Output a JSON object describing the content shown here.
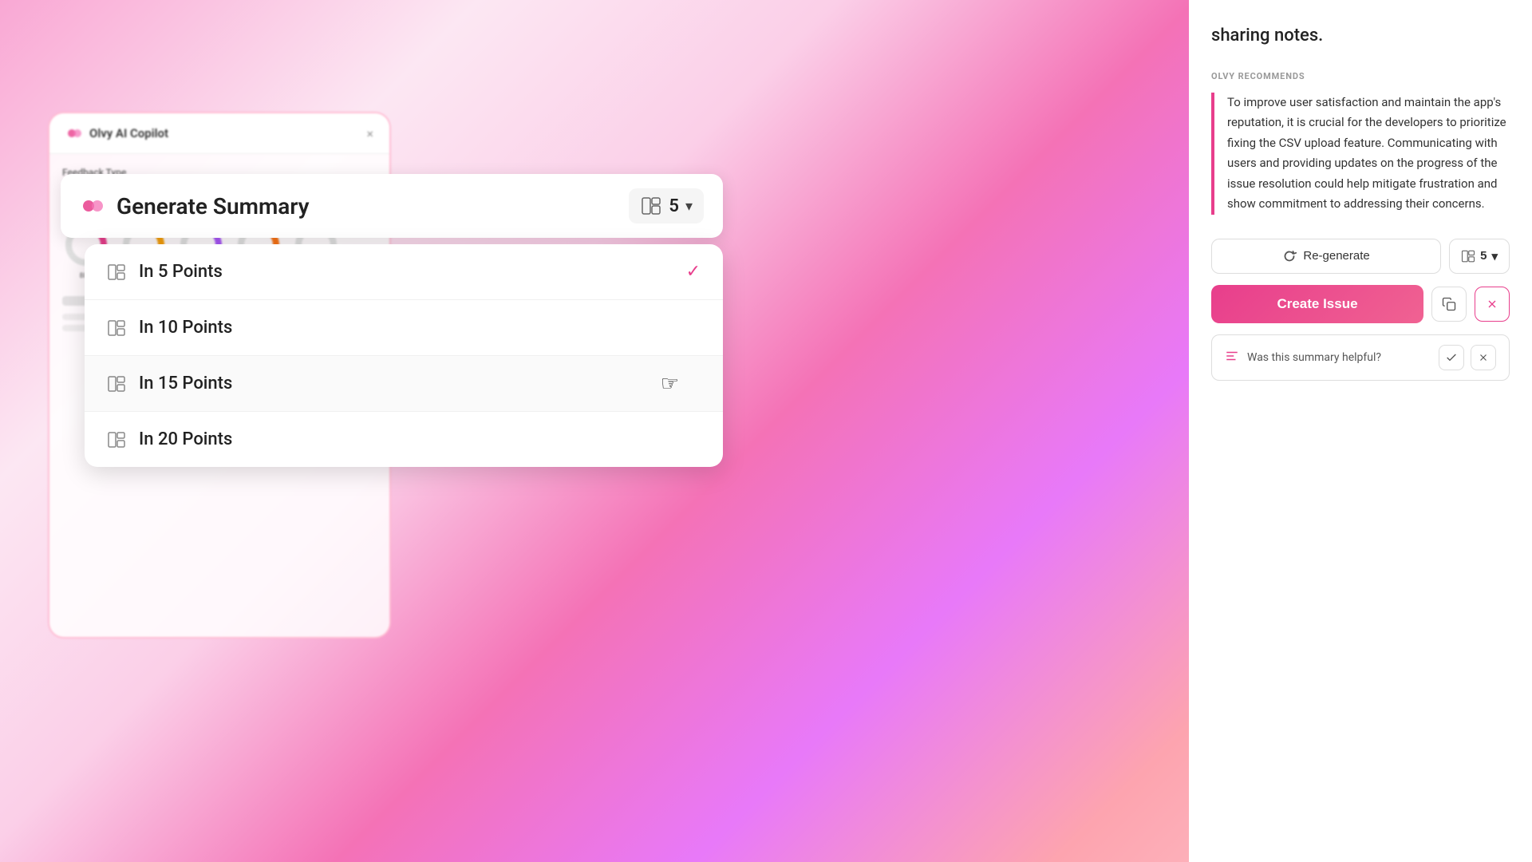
{
  "background": {
    "gradient": "pink-purple"
  },
  "left_panel": {
    "title": "Olvy AI Copilot",
    "close_label": "×",
    "feedback_type_label": "Feedback Type"
  },
  "generate_summary": {
    "logo_alt": "Olvy logo",
    "title": "Generate Summary",
    "selected_points": "5",
    "chevron": "▾"
  },
  "dropdown": {
    "items": [
      {
        "id": "5",
        "label": "In 5 Points",
        "selected": true
      },
      {
        "id": "10",
        "label": "In 10 Points",
        "selected": false
      },
      {
        "id": "15",
        "label": "In 15 Points",
        "selected": false,
        "hovered": true
      },
      {
        "id": "20",
        "label": "In 20 Points",
        "selected": false
      }
    ]
  },
  "right_panel": {
    "sharing_text": "sharing notes.",
    "olvy_recommends_label": "OLVY RECOMMENDS",
    "recommendation": "To improve user satisfaction and maintain the app's reputation, it is crucial for the developers to prioritize fixing the CSV upload feature. Communicating with users and providing updates on the progress of the issue resolution could help mitigate frustration and show commitment to addressing their concerns.",
    "re_generate_label": "Re-generate",
    "re_generate_points": "5",
    "re_generate_chevron": "▾",
    "create_issue_label": "Create Issue",
    "copy_icon": "⧉",
    "dismiss_icon": "✕",
    "helpful_text": "Was this summary helpful?",
    "thumbs_up": "✓",
    "thumbs_down": "✕"
  }
}
